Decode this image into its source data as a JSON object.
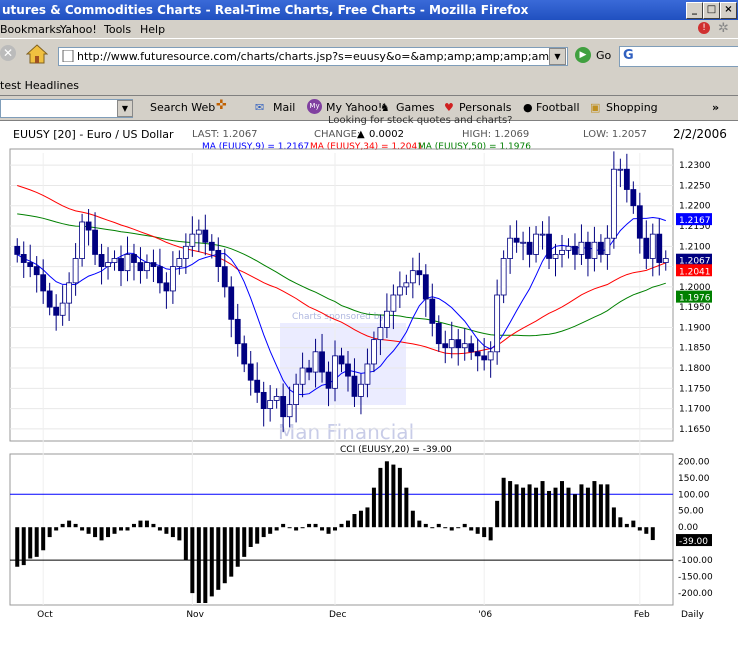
{
  "window": {
    "title": "utures & Commodities Charts - Real-Time Charts, Free Charts - Mozilla Firefox",
    "buttons": [
      "_",
      "□",
      "×"
    ]
  },
  "menu": [
    "Bookmarks",
    "Yahoo!",
    "Tools",
    "Help"
  ],
  "nav": {
    "url": "http://www.futuresource.com/charts/charts.jsp?s=euusy&o=&amp;amp;amp;amp;amp;amp;amp;amp;amp;a",
    "go": "Go"
  },
  "bookmarks": {
    "item": "test Headlines"
  },
  "ytoolbar": {
    "search": "Search Web",
    "mail": "Mail",
    "myyahoo": "My Yahoo!",
    "games": "Games",
    "personals": "Personals",
    "football": "Football",
    "shopping": "Shopping",
    "more": "»"
  },
  "link_partial": "Looking for stock quotes and charts?",
  "chart_header": {
    "symbol": "EUUSY [20] - Euro / US Dollar",
    "last": "LAST: 1.2067",
    "change": "CHANGE:",
    "change_val": "0.0002",
    "high": "HIGH: 1.2069",
    "low": "LOW: 1.2057",
    "date": "2/2/2006"
  },
  "ma_legend": {
    "ma9": "MA (EUUSY,9) = 1.2167",
    "ma34": "MA (EUUSY,34) = 1.2041",
    "ma50": "MA (EUUSY,50) = 1.1976"
  },
  "watermark": {
    "sponsor": "Charts sponsored by",
    "name": "Man Financial"
  },
  "cci_label": "CCI (EUUSY,20) = -39.00",
  "colors": {
    "ma9": "#0000ff",
    "ma34": "#ff0000",
    "ma50": "#008000",
    "candle": "#000080"
  },
  "chart_data": [
    {
      "type": "candlestick",
      "title": "EUUSY [20] - Euro / US Dollar",
      "x_ticks": [
        "Oct",
        "Nov",
        "Dec",
        "'06",
        "Feb",
        "Daily"
      ],
      "y_ticks": [
        "1.2300",
        "1.2250",
        "1.2200",
        "1.2150",
        "1.2100",
        "1.2050",
        "1.2000",
        "1.1950",
        "1.1900",
        "1.1850",
        "1.1800",
        "1.1750",
        "1.1700",
        "1.1650"
      ],
      "ylim": [
        1.163,
        1.233
      ],
      "last_labels": {
        "ma9": "1.2167",
        "last": "1.2067",
        "ma34": "1.2041",
        "ma50": "1.1976"
      },
      "close_path": [
        1.208,
        1.206,
        1.205,
        1.203,
        1.199,
        1.195,
        1.193,
        1.196,
        1.201,
        1.207,
        1.216,
        1.214,
        1.208,
        1.205,
        1.206,
        1.207,
        1.204,
        1.208,
        1.206,
        1.204,
        1.206,
        1.205,
        1.201,
        1.199,
        1.205,
        1.207,
        1.21,
        1.213,
        1.214,
        1.211,
        1.209,
        1.205,
        1.2,
        1.192,
        1.186,
        1.181,
        1.177,
        1.174,
        1.17,
        1.172,
        1.173,
        1.168,
        1.171,
        1.176,
        1.18,
        1.179,
        1.184,
        1.179,
        1.175,
        1.183,
        1.181,
        1.178,
        1.173,
        1.176,
        1.181,
        1.187,
        1.19,
        1.194,
        1.198,
        1.2,
        1.201,
        1.204,
        1.203,
        1.197,
        1.191,
        1.186,
        1.185,
        1.187,
        1.185,
        1.186,
        1.184,
        1.183,
        1.182,
        1.184,
        1.198,
        1.207,
        1.212,
        1.211,
        1.211,
        1.208,
        1.213,
        1.213,
        1.207,
        1.208,
        1.209,
        1.21,
        1.208,
        1.211,
        1.207,
        1.211,
        1.208,
        1.212,
        1.229,
        1.229,
        1.224,
        1.22,
        1.212,
        1.207,
        1.213,
        1.206,
        1.207
      ]
    },
    {
      "type": "bar",
      "title": "CCI (EUUSY,20) = -39.00",
      "y_ticks": [
        "200.00",
        "150.00",
        "100.00",
        "50.00",
        "0.00",
        "-39.00",
        "-100.00",
        "-150.00",
        "-200.00"
      ],
      "ylim": [
        -230,
        210
      ],
      "ref_lines": [
        100,
        -100
      ],
      "values": [
        -120,
        -115,
        -95,
        -90,
        -70,
        -30,
        -10,
        10,
        20,
        10,
        -10,
        -20,
        -30,
        -40,
        -30,
        -20,
        -10,
        -10,
        10,
        20,
        20,
        10,
        -10,
        -20,
        -30,
        -40,
        -100,
        -200,
        -230,
        -230,
        -210,
        -190,
        -170,
        -150,
        -120,
        -90,
        -60,
        -50,
        -30,
        -20,
        -10,
        10,
        0,
        -10,
        0,
        10,
        10,
        -10,
        -20,
        -10,
        10,
        20,
        40,
        50,
        60,
        120,
        180,
        200,
        190,
        180,
        120,
        50,
        20,
        10,
        0,
        10,
        0,
        -10,
        0,
        10,
        -10,
        -20,
        -30,
        -40,
        80,
        150,
        140,
        130,
        120,
        130,
        120,
        140,
        110,
        120,
        140,
        120,
        100,
        130,
        120,
        140,
        130,
        130,
        60,
        30,
        10,
        20,
        -10,
        -20,
        -39
      ]
    }
  ]
}
